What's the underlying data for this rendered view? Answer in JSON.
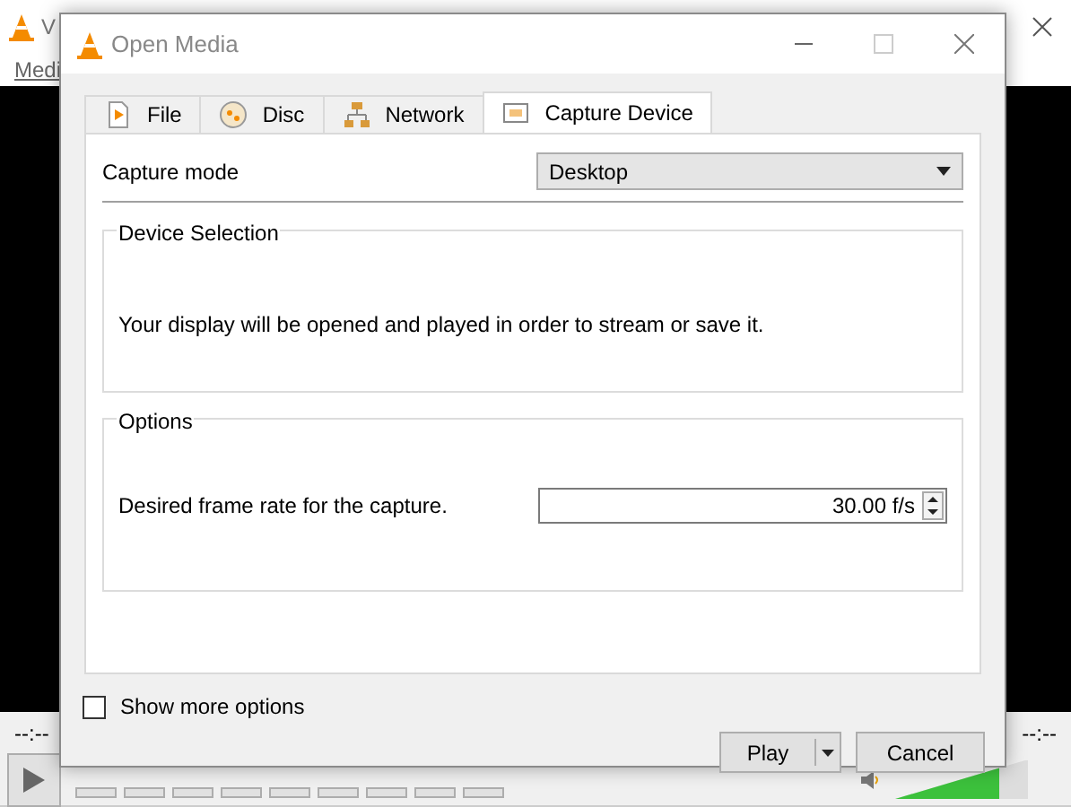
{
  "background_window": {
    "title": "V",
    "menu": [
      "Medi"
    ],
    "time_elapsed": "--:--",
    "time_total": "--:--",
    "volume": {
      "level": 0.78
    }
  },
  "dialog": {
    "title": "Open Media",
    "tabs": [
      {
        "label": "File",
        "kind": "file",
        "selected": false
      },
      {
        "label": "Disc",
        "kind": "disc",
        "selected": false
      },
      {
        "label": "Network",
        "kind": "network",
        "selected": false
      },
      {
        "label": "Capture Device",
        "kind": "capture",
        "selected": true
      }
    ],
    "capture_mode": {
      "label": "Capture mode",
      "value": "Desktop"
    },
    "device_selection": {
      "title": "Device Selection",
      "text": "Your display will be opened and played in order to stream or save it."
    },
    "options": {
      "title": "Options",
      "frame_rate": {
        "label": "Desired frame rate for the capture.",
        "value": "30.00 f/s"
      }
    },
    "show_more_options": {
      "label": "Show more options",
      "checked": false
    },
    "buttons": [
      {
        "label": "Play",
        "kind": "split"
      },
      {
        "label": "Cancel",
        "kind": "plain"
      }
    ]
  }
}
